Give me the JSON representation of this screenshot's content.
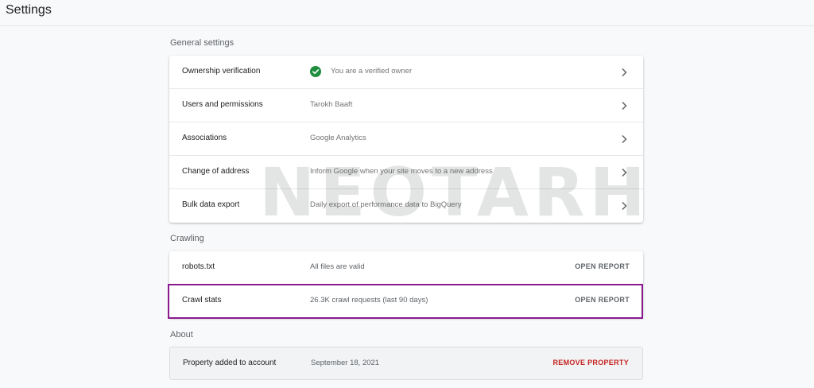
{
  "page": {
    "title": "Settings"
  },
  "general_settings": {
    "heading": "General settings",
    "rows": [
      {
        "label": "Ownership verification",
        "value": "You are a verified owner"
      },
      {
        "label": "Users and permissions",
        "value": "Tarokh Baaft"
      },
      {
        "label": "Associations",
        "value": "Google Analytics"
      },
      {
        "label": "Change of address",
        "value": "Inform Google when your site moves to a new address"
      },
      {
        "label": "Bulk data export",
        "value": "Daily export of performance data to BigQuery"
      }
    ]
  },
  "crawling": {
    "heading": "Crawling",
    "rows": [
      {
        "label": "robots.txt",
        "value": "All files are valid",
        "action": "OPEN REPORT"
      },
      {
        "label": "Crawl stats",
        "value": "26.3K crawl requests (last 90 days)",
        "action": "OPEN REPORT"
      }
    ]
  },
  "about": {
    "heading": "About",
    "label": "Property added to account",
    "value": "September 18, 2021",
    "action": "REMOVE PROPERTY"
  },
  "watermark": {
    "text": "NEOTARH"
  },
  "colors": {
    "verified_green": "#1e8e3e",
    "highlight_border": "#8a1a8e",
    "danger_red": "#c5221f"
  },
  "icons": {
    "verified": "check-circle-icon",
    "row_nav": "chevron-right-icon"
  }
}
